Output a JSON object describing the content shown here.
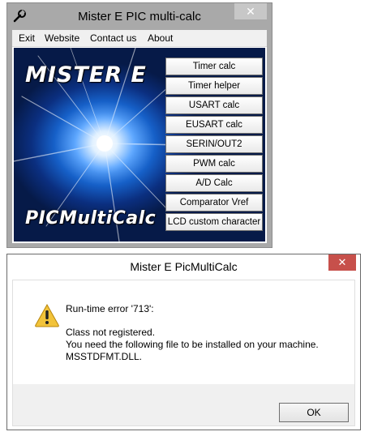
{
  "main_window": {
    "title": "Mister E PIC multi-calc",
    "close_glyph": "✕",
    "app_icon": "wrench-icon",
    "menu": [
      "Exit",
      "Website",
      "Contact us",
      "About"
    ],
    "logo_top": "MISTER E",
    "logo_bottom": "PICMultiCalc",
    "buttons": [
      "Timer calc",
      "Timer helper",
      "USART calc",
      "EUSART calc",
      "SERIN/OUT2",
      "PWM calc",
      "A/D Calc",
      "Comparator Vref",
      "LCD custom character"
    ]
  },
  "error_dialog": {
    "title": "Mister E PicMultiCalc",
    "close_glyph": "✕",
    "icon": "warning-icon",
    "lines": [
      "Run-time error '713':",
      "Class not registered.",
      "You need the following file to be installed on your machine.",
      "MSSTDFMT.DLL."
    ],
    "ok_label": "OK"
  },
  "colors": {
    "title_bar_inactive": "#a9a9a9",
    "close_button_red": "#c7504b",
    "warning_yellow": "#f2c33a"
  }
}
